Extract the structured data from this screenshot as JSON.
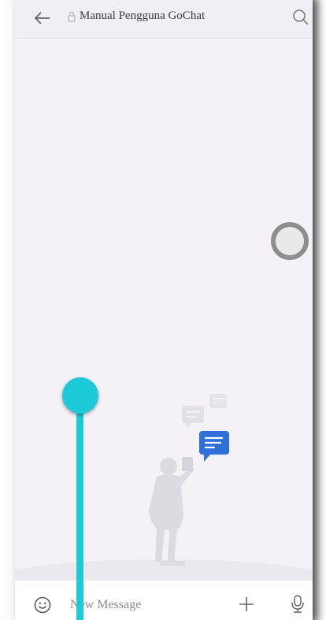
{
  "header": {
    "title": "Manual Pengguna GoChat",
    "back_icon": "arrow-left-icon",
    "lock_icon": "lock-icon",
    "search_icon": "search-icon"
  },
  "chat": {
    "loading_icon": "loading-ring-icon",
    "empty_illustration": "person-reading-chat-bubbles-illustration"
  },
  "composer": {
    "placeholder": "New Message",
    "emoji_icon": "smiley-icon",
    "attach_icon": "plus-icon",
    "voice_icon": "microphone-icon"
  },
  "colors": {
    "background": "#f4f2f7",
    "accent_bubble": "#2f6fdc",
    "touch_indicator": "#1ccad8"
  }
}
